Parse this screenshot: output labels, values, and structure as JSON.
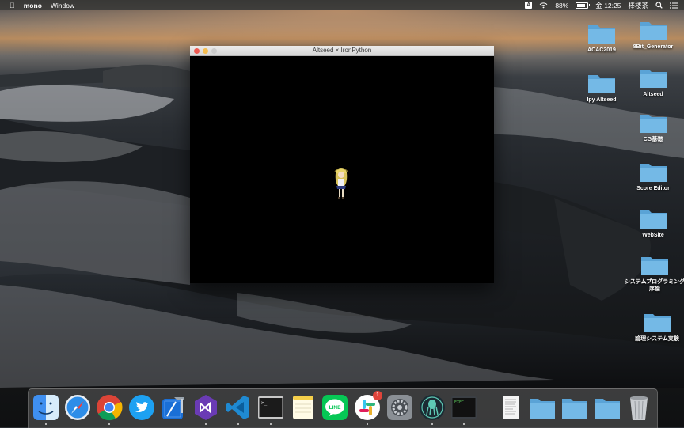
{
  "menubar": {
    "apple_icon": "apple-logo",
    "app_name": "mono",
    "menus": [
      "Window"
    ],
    "input_method": "A",
    "battery_percent": "88%",
    "clock": "金 12:25",
    "user": "棒楼茶"
  },
  "window": {
    "title": "Altseed × IronPython"
  },
  "desktop_icons": [
    {
      "label": "ACAC2019"
    },
    {
      "label": "8Bit_Generator"
    },
    {
      "label": "Ipy Altseed"
    },
    {
      "label": "Altseed"
    },
    {
      "label": "CG基礎"
    },
    {
      "label": "Score Editor"
    },
    {
      "label": "WebSite"
    },
    {
      "label": "システムプログラミング序論"
    },
    {
      "label": "論理システム実験"
    }
  ],
  "dock": {
    "apps": [
      "Finder",
      "Safari",
      "Chrome",
      "Twitter",
      "Xcode",
      "Visual Studio",
      "VS Code",
      "Terminal",
      "Notes",
      "LINE",
      "Slack",
      "System Preferences",
      "GitKraken",
      "Script Editor",
      "Document",
      "Folder",
      "Folder",
      "Folder",
      "Trash"
    ],
    "slack_badge": "1",
    "terminal_prompt": ">_",
    "script_label": "EXEC",
    "line_label": "LINE"
  },
  "colors": {
    "folder": "#6fb3e0",
    "close": "#ee5a52",
    "minimize": "#f5bd4f"
  }
}
